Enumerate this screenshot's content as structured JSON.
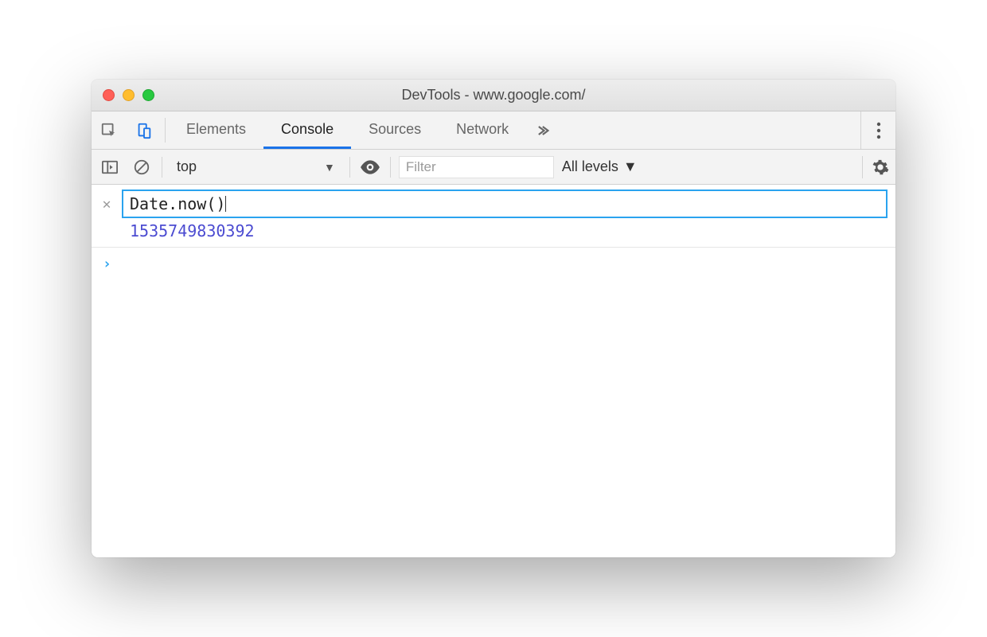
{
  "window": {
    "title": "DevTools - www.google.com/"
  },
  "tabs": {
    "elements": "Elements",
    "console": "Console",
    "sources": "Sources",
    "network": "Network"
  },
  "toolbar": {
    "context": "top",
    "filter_placeholder": "Filter",
    "filter_value": "",
    "levels_label": "All levels"
  },
  "console": {
    "live_expression": "Date.now()",
    "live_result": "1535749830392"
  }
}
